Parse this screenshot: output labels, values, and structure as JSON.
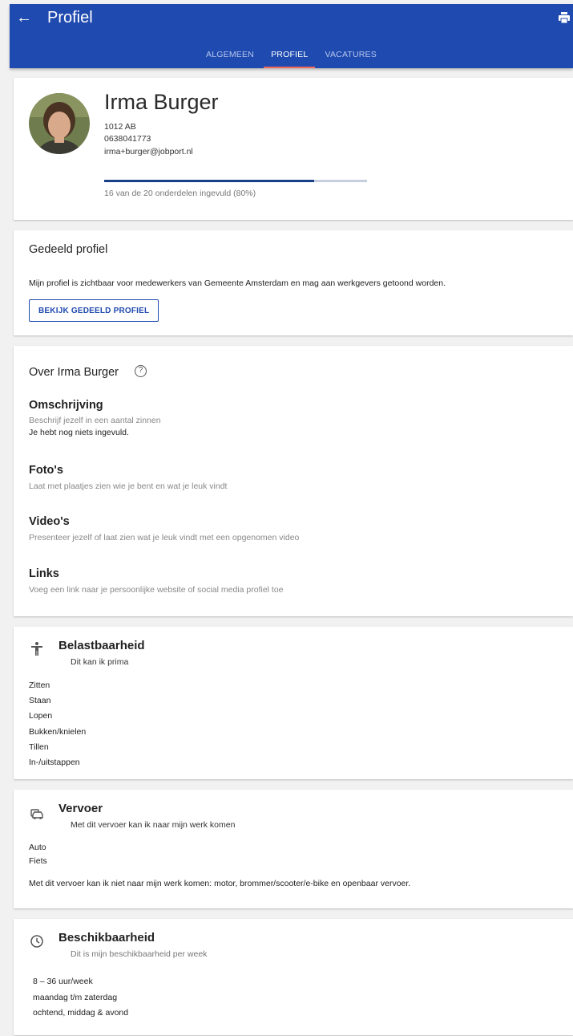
{
  "header": {
    "title": "Profiel",
    "tabs": [
      {
        "label": "ALGEMEEN",
        "active": false
      },
      {
        "label": "PROFIEL",
        "active": true
      },
      {
        "label": "VACATURES",
        "active": false
      }
    ],
    "icons": {
      "back": "arrow-left-icon",
      "print": "printer-icon"
    },
    "colors": {
      "appbar": "#1f4aaf",
      "tab_indicator": "#f06a5c"
    }
  },
  "profile": {
    "name": "Irma Burger",
    "postcode": "1012 AB",
    "phone": "0638041773",
    "email": "irma+burger@jobport.nl",
    "progress_fraction": 0.8,
    "progress_text": "16 van de 20 onderdelen ingevuld (80%)"
  },
  "shared": {
    "title": "Gedeeld profiel",
    "text": "Mijn profiel is zichtbaar voor medewerkers van Gemeente Amsterdam en mag aan werkgevers getoond worden.",
    "button": "BEKIJK GEDEELD PROFIEL"
  },
  "about": {
    "title": "Over Irma Burger",
    "help_icon": "?",
    "description_title": "Omschrijving",
    "description_hint": "Beschrijf jezelf in een aantal zinnen",
    "description_value": "Je hebt nog niets ingevuld.",
    "photos_title": "Foto's",
    "photos_hint": "Laat met plaatjes zien wie je bent en wat je leuk vindt",
    "videos_title": "Video's",
    "videos_hint": "Presenteer jezelf of laat zien wat je leuk vindt met een opgenomen video",
    "links_title": "Links",
    "links_hint": "Voeg een link naar je persoonlijke website of social media profiel toe"
  },
  "load": {
    "title": "Belastbaarheid",
    "subtitle": "Dit kan ik prima",
    "items": [
      "Zitten",
      "Staan",
      "Lopen",
      "Bukken/knielen",
      "Tillen",
      "In-/uitstappen"
    ]
  },
  "transport": {
    "title": "Vervoer",
    "subtitle": "Met dit vervoer kan ik naar mijn werk komen",
    "items": [
      "Auto",
      "Fiets"
    ],
    "note": "Met dit vervoer kan ik niet naar mijn werk komen: motor, brommer/scooter/e-bike en openbaar vervoer."
  },
  "availability": {
    "title": "Beschikbaarheid",
    "subtitle": "Dit is mijn beschikbaarheid per week",
    "hours": "8 – 36 uur/week",
    "days": "maandag t/m zaterdag",
    "parts": "ochtend, middag & avond"
  }
}
